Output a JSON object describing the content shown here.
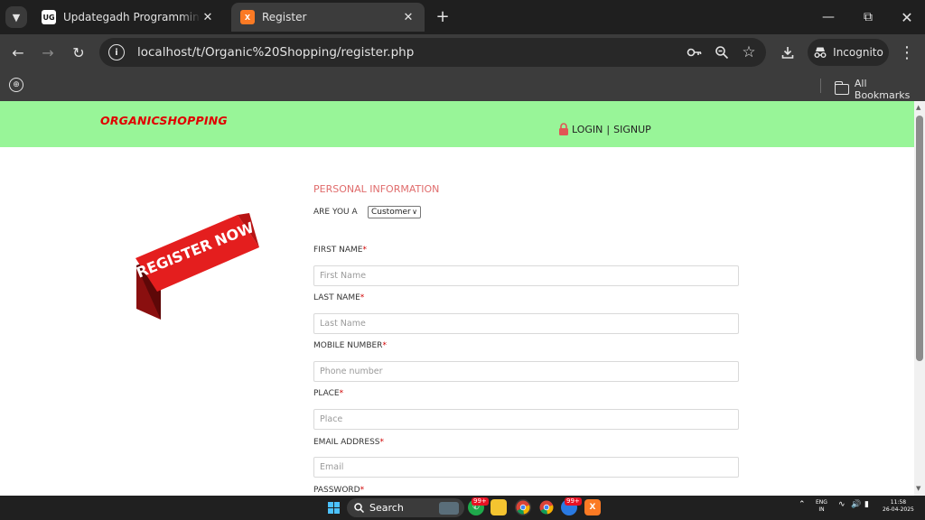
{
  "browser": {
    "tabs": [
      {
        "title": "Updategadh Programming - Upda",
        "favicon": "UG",
        "icon": "updategadh-favicon-icon"
      },
      {
        "title": "Register",
        "favicon": "X",
        "icon": "xampp-favicon-icon"
      }
    ],
    "url": "localhost/t/Organic%20Shopping/register.php",
    "incognito_label": "Incognito",
    "all_bookmarks_label": "All Bookmarks"
  },
  "site": {
    "brand": "ORGANICSHOPPING",
    "login_label": "LOGIN",
    "separator": "|",
    "signup_label": "SIGNUP"
  },
  "banner": {
    "text": "REGISTER NOW"
  },
  "form": {
    "section_title": "PERSONAL INFORMATION",
    "role_label": "ARE YOU A",
    "role_value": "Customer",
    "required_mark": "*",
    "fields": [
      {
        "label": "FIRST NAME",
        "placeholder": "First Name"
      },
      {
        "label": "LAST NAME",
        "placeholder": "Last Name"
      },
      {
        "label": "MOBILE NUMBER",
        "placeholder": "Phone number"
      },
      {
        "label": "PLACE",
        "placeholder": "Place"
      },
      {
        "label": "EMAIL ADDRESS",
        "placeholder": "Email"
      },
      {
        "label": "PASSWORD",
        "placeholder": ""
      }
    ]
  },
  "taskbar": {
    "search_label": "Search",
    "badge_whatsapp": "99+",
    "badge_app": "99+",
    "lang_line1": "ENG",
    "lang_line2": "IN",
    "time": "11:58",
    "date": "26-04-2025"
  },
  "colors": {
    "header_bg": "#98f598",
    "brand": "#e00000",
    "section_title": "#e06c6c",
    "required": "#d00000",
    "banner_red": "#e41e1e"
  }
}
